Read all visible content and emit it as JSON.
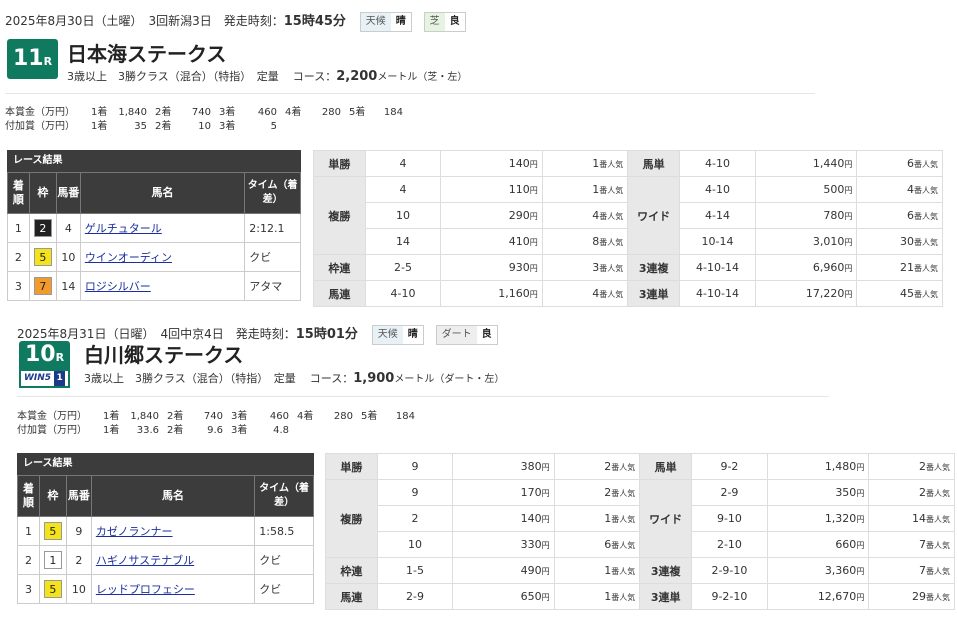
{
  "races": [
    {
      "date": "2025年8月30日（土曜）",
      "meeting": "3回新潟3日",
      "start_label": "発走時刻：",
      "start_time": "15時45分",
      "weather_label": "天候",
      "weather": "晴",
      "surface": "芝",
      "condition": "良",
      "race_no": "11",
      "race_suffix": "R",
      "name": "日本海ステークス",
      "info": "3歳以上　3勝クラス（混合）（特指）　定量",
      "course_label": "コース：",
      "distance": "2,200",
      "course_unit": "メートル（芝・左）",
      "prize_rows": [
        {
          "label": "本賞金（万円）",
          "cells": [
            "1着",
            "1,840",
            "2着",
            "740",
            "3着",
            "460",
            "4着",
            "280",
            "5着",
            "184"
          ]
        },
        {
          "label": "付加賞（万円）",
          "cells": [
            "1着",
            "35",
            "2着",
            "10",
            "3着",
            "5"
          ]
        }
      ],
      "results_caption": "レース結果",
      "results_headers": [
        "着順",
        "枠",
        "馬番",
        "馬名",
        "タイム（着差）"
      ],
      "results": [
        {
          "pos": "1",
          "waku": "2",
          "num": "4",
          "horse": "ゲルチュタール",
          "time": "2:12.1"
        },
        {
          "pos": "2",
          "waku": "5",
          "num": "10",
          "horse": "ウインオーディン",
          "time": "クビ"
        },
        {
          "pos": "3",
          "waku": "7",
          "num": "14",
          "horse": "ロジシルバー",
          "time": "アタマ"
        }
      ],
      "payouts_left": [
        {
          "bet": "単勝",
          "rows": [
            {
              "combo": "4",
              "amount": "140",
              "pop": "1"
            }
          ]
        },
        {
          "bet": "複勝",
          "rows": [
            {
              "combo": "4",
              "amount": "110",
              "pop": "1"
            },
            {
              "combo": "10",
              "amount": "290",
              "pop": "4"
            },
            {
              "combo": "14",
              "amount": "410",
              "pop": "8"
            }
          ]
        },
        {
          "bet": "枠連",
          "rows": [
            {
              "combo": "2-5",
              "amount": "930",
              "pop": "3"
            }
          ]
        },
        {
          "bet": "馬連",
          "rows": [
            {
              "combo": "4-10",
              "amount": "1,160",
              "pop": "4"
            }
          ]
        }
      ],
      "payouts_right": [
        {
          "bet": "馬単",
          "rows": [
            {
              "combo": "4-10",
              "amount": "1,440",
              "pop": "6"
            }
          ]
        },
        {
          "bet": "ワイド",
          "rows": [
            {
              "combo": "4-10",
              "amount": "500",
              "pop": "4"
            },
            {
              "combo": "4-14",
              "amount": "780",
              "pop": "6"
            },
            {
              "combo": "10-14",
              "amount": "3,010",
              "pop": "30"
            }
          ]
        },
        {
          "bet": "3連複",
          "rows": [
            {
              "combo": "4-10-14",
              "amount": "6,960",
              "pop": "21"
            }
          ]
        },
        {
          "bet": "3連単",
          "rows": [
            {
              "combo": "4-10-14",
              "amount": "17,220",
              "pop": "45"
            }
          ]
        }
      ]
    },
    {
      "date": "2025年8月31日（日曜）",
      "meeting": "4回中京4日",
      "start_label": "発走時刻：",
      "start_time": "15時01分",
      "weather_label": "天候",
      "weather": "晴",
      "surface": "ダート",
      "condition": "良",
      "race_no": "10",
      "race_suffix": "R",
      "name": "白川郷ステークス",
      "win5_label": "WIN5",
      "win5_leg": "1",
      "info": "3歳以上　3勝クラス（混合）（特指）　定量",
      "course_label": "コース：",
      "distance": "1,900",
      "course_unit": "メートル（ダート・左）",
      "prize_rows": [
        {
          "label": "本賞金（万円）",
          "cells": [
            "1着",
            "1,840",
            "2着",
            "740",
            "3着",
            "460",
            "4着",
            "280",
            "5着",
            "184"
          ]
        },
        {
          "label": "付加賞（万円）",
          "cells": [
            "1着",
            "33.6",
            "2着",
            "9.6",
            "3着",
            "4.8"
          ]
        }
      ],
      "results_caption": "レース結果",
      "results_headers": [
        "着順",
        "枠",
        "馬番",
        "馬名",
        "タイム（着差）"
      ],
      "results": [
        {
          "pos": "1",
          "waku": "5",
          "num": "9",
          "horse": "カゼノランナー",
          "time": "1:58.5"
        },
        {
          "pos": "2",
          "waku": "1",
          "num": "2",
          "horse": "ハギノサステナブル",
          "time": "クビ"
        },
        {
          "pos": "3",
          "waku": "5",
          "num": "10",
          "horse": "レッドプロフェシー",
          "time": "クビ"
        }
      ],
      "payouts_left": [
        {
          "bet": "単勝",
          "rows": [
            {
              "combo": "9",
              "amount": "380",
              "pop": "2"
            }
          ]
        },
        {
          "bet": "複勝",
          "rows": [
            {
              "combo": "9",
              "amount": "170",
              "pop": "2"
            },
            {
              "combo": "2",
              "amount": "140",
              "pop": "1"
            },
            {
              "combo": "10",
              "amount": "330",
              "pop": "6"
            }
          ]
        },
        {
          "bet": "枠連",
          "rows": [
            {
              "combo": "1-5",
              "amount": "490",
              "pop": "1"
            }
          ]
        },
        {
          "bet": "馬連",
          "rows": [
            {
              "combo": "2-9",
              "amount": "650",
              "pop": "1"
            }
          ]
        }
      ],
      "payouts_right": [
        {
          "bet": "馬単",
          "rows": [
            {
              "combo": "9-2",
              "amount": "1,480",
              "pop": "2"
            }
          ]
        },
        {
          "bet": "ワイド",
          "rows": [
            {
              "combo": "2-9",
              "amount": "350",
              "pop": "2"
            },
            {
              "combo": "9-10",
              "amount": "1,320",
              "pop": "14"
            },
            {
              "combo": "2-10",
              "amount": "660",
              "pop": "7"
            }
          ]
        },
        {
          "bet": "3連複",
          "rows": [
            {
              "combo": "2-9-10",
              "amount": "3,360",
              "pop": "7"
            }
          ]
        },
        {
          "bet": "3連単",
          "rows": [
            {
              "combo": "9-2-10",
              "amount": "12,670",
              "pop": "29"
            }
          ]
        }
      ]
    }
  ],
  "yen_unit": "円",
  "pop_unit": "番人気",
  "waku_colors": {
    "1": "#ffffff",
    "2": "#222222",
    "5": "#f4e21a",
    "7": "#f39a2d"
  },
  "waku_text": {
    "1": "#222222",
    "2": "#ffffff",
    "5": "#222222",
    "7": "#222222"
  },
  "accent_green": "#0f7a60",
  "win5_blue": "#1a3a8a"
}
